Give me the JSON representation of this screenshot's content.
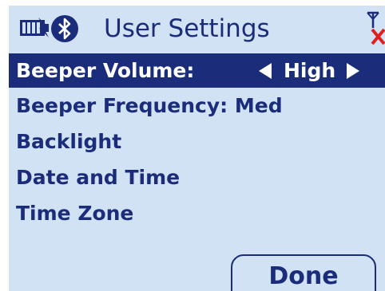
{
  "header": {
    "title": "User Settings",
    "icons": [
      "battery-icon",
      "bluetooth-icon",
      "no-signal-icon"
    ]
  },
  "menu": {
    "items": [
      {
        "label": "Beeper Volume:",
        "value": "High",
        "selected": true
      },
      {
        "label": "Beeper Frequency: Med"
      },
      {
        "label": "Backlight"
      },
      {
        "label": "Date and Time"
      },
      {
        "label": "Time Zone"
      }
    ]
  },
  "footer": {
    "done_label": "Done"
  },
  "colors": {
    "background": "#d0e2f3",
    "text": "#1a2c7a",
    "highlight": "#1a2c7a",
    "highlight_text": "#ffffff",
    "error": "#e02020"
  }
}
